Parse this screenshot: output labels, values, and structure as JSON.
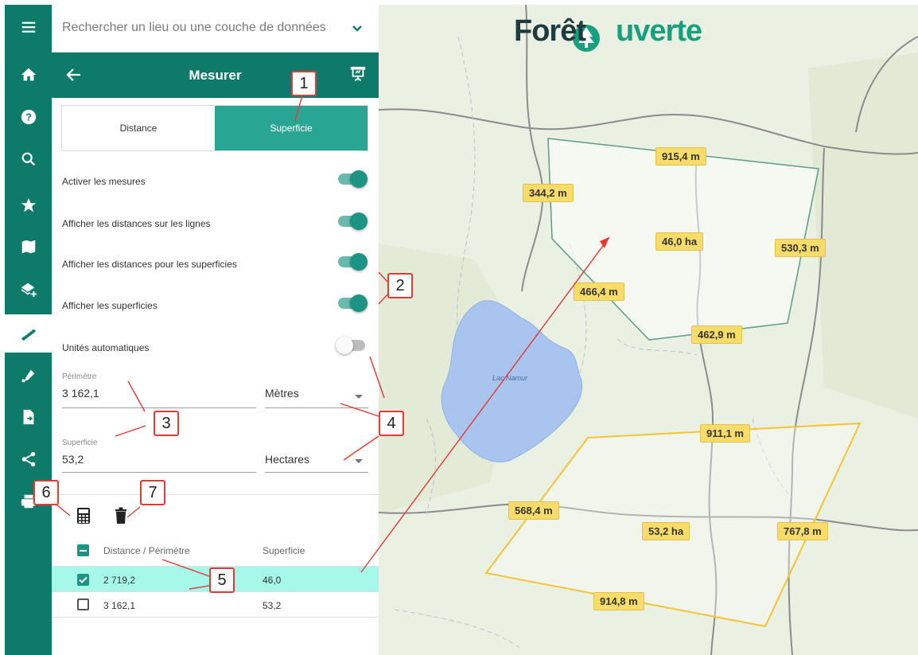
{
  "search": {
    "placeholder": "Rechercher un lieu ou une couche de données"
  },
  "rail": {
    "items": [
      {
        "icon": "menu-icon"
      },
      {
        "icon": "home-icon"
      },
      {
        "icon": "help-icon"
      },
      {
        "icon": "search-icon"
      },
      {
        "icon": "star-icon"
      },
      {
        "icon": "map-icon"
      },
      {
        "icon": "add-layer-icon"
      },
      {
        "icon": "ruler-icon",
        "active": true
      },
      {
        "icon": "draw-icon"
      },
      {
        "icon": "export-file-icon"
      },
      {
        "icon": "share-icon"
      },
      {
        "icon": "print-icon"
      }
    ]
  },
  "panel": {
    "title": "Mesurer",
    "tabs": [
      "Distance",
      "Superficie"
    ],
    "active_tab": "Superficie",
    "toggles": [
      {
        "label": "Activer les mesures",
        "on": true
      },
      {
        "label": "Afficher les distances sur les lignes",
        "on": true
      },
      {
        "label": "Afficher les distances pour les superficies",
        "on": true
      },
      {
        "label": "Afficher les superficies",
        "on": true
      },
      {
        "label": "Unités automatiques",
        "on": false
      }
    ],
    "perimeter": {
      "label": "Périmètre",
      "value": "3 162,1",
      "unit": "Mètres"
    },
    "area": {
      "label": "Superficie",
      "value": "53,2",
      "unit": "Hectares"
    },
    "table": {
      "headers": [
        "Distance / Périmètre",
        "Superficie"
      ],
      "rows": [
        {
          "distance": "2 719,2",
          "area": "46,0",
          "checked": true
        },
        {
          "distance": "3 162,1",
          "area": "53,2",
          "checked": false
        }
      ]
    }
  },
  "map": {
    "logo_left": "Forêt",
    "logo_right": "uverte",
    "lake_label": "Lac Namur",
    "polygon1_labels": [
      "915,4 m",
      "344,2 m",
      "46,0 ha",
      "530,3 m",
      "466,4 m",
      "462,9 m"
    ],
    "polygon2_labels": [
      "911,1 m",
      "568,4 m",
      "53,2 ha",
      "767,8 m",
      "914,8 m"
    ]
  },
  "callouts": [
    "1",
    "2",
    "3",
    "4",
    "5",
    "6",
    "7"
  ],
  "colors": {
    "primary": "#0e7a6a",
    "tab_active": "#29a593",
    "row_selected": "#a6f8e8",
    "label_fill": "#f8dc6a",
    "polygon_selected": "#5a9c86",
    "polygon_other": "#f5c435",
    "lake": "#a9c4ef",
    "callout_border": "#e53935"
  }
}
